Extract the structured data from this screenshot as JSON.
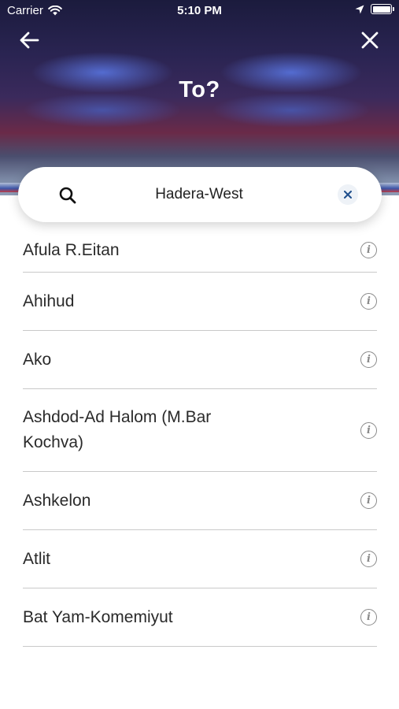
{
  "status_bar": {
    "carrier": "Carrier",
    "time": "5:10 PM"
  },
  "header": {
    "title": "To?"
  },
  "search": {
    "value": "Hadera-West"
  },
  "stations": [
    {
      "name": "Afula R.Eitan"
    },
    {
      "name": "Ahihud"
    },
    {
      "name": "Ako"
    },
    {
      "name": "Ashdod-Ad Halom (M.Bar Kochva)"
    },
    {
      "name": "Ashkelon"
    },
    {
      "name": "Atlit"
    },
    {
      "name": "Bat Yam-Komemiyut"
    }
  ],
  "icons": {
    "back": "arrow-left-icon",
    "close": "close-icon",
    "search": "search-icon",
    "clear": "clear-icon",
    "info": "info-icon"
  },
  "colors": {
    "clear_icon": "#1f4e8c",
    "info_icon": "#8a8a8a",
    "divider": "#c9c9c9"
  }
}
